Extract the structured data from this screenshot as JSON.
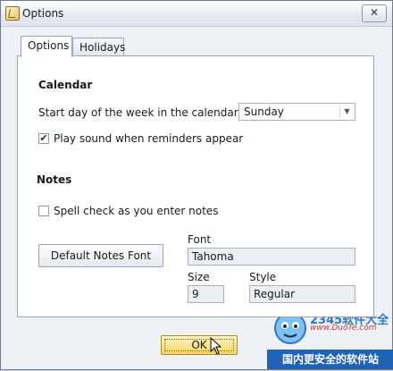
{
  "window": {
    "title": "Options",
    "close_glyph": "✕"
  },
  "tabs": [
    {
      "label": "Options",
      "active": true
    },
    {
      "label": "Holidays",
      "active": false
    }
  ],
  "calendar": {
    "heading": "Calendar",
    "start_day_label": "Start day of the week in the calendar",
    "start_day_value": "Sunday",
    "play_sound_label": "Play sound when reminders appear",
    "play_sound_checked": true
  },
  "notes": {
    "heading": "Notes",
    "spell_check_label": "Spell check as you enter notes",
    "spell_check_checked": false,
    "default_font_button": "Default Notes Font",
    "font_label": "Font",
    "font_value": "Tahoma",
    "size_label": "Size",
    "size_value": "9",
    "style_label": "Style",
    "style_value": "Regular"
  },
  "footer": {
    "ok_label": "OK"
  },
  "watermark": {
    "logo": "2345软件大全",
    "url": "www.DuoTe.com",
    "banner": "国内更安全的软件站"
  },
  "colors": {
    "accent": "#1e63b5",
    "ok_button": "#f6d560"
  },
  "icons": {
    "app": "options-app-icon",
    "close": "close-icon",
    "dropdown": "chevron-down-icon",
    "check": "checkmark-icon",
    "cursor": "mouse-pointer-icon"
  }
}
